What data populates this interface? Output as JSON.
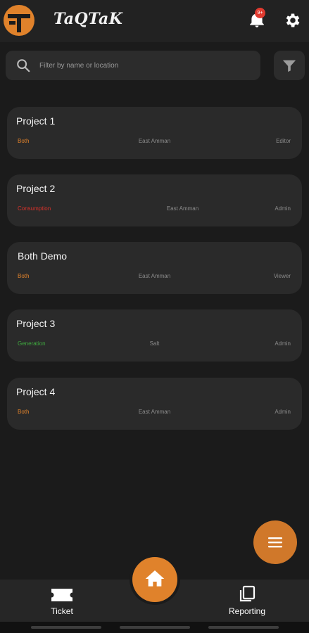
{
  "colors": {
    "accent": "#e0822b",
    "background": "#1b1b1b",
    "card": "#2a2a2a",
    "type_both": "#e0822b",
    "type_consumption": "#d9322a",
    "type_generation": "#3fa83f"
  },
  "header": {
    "title": "TaQTaK",
    "logo_icon": "taqtak-logo-icon",
    "notifications_icon": "bell-icon",
    "notifications_badge": "9+",
    "settings_icon": "gear-icon"
  },
  "search": {
    "placeholder": "Filter by name or location",
    "value": "",
    "icon": "search-icon",
    "filter_icon": "filter-icon"
  },
  "projects": [
    {
      "name": "Project 1",
      "type": "Both",
      "type_color": "#e0822b",
      "location": "East Amman",
      "role": "Editor"
    },
    {
      "name": "Project 2",
      "type": "Consumption",
      "type_color": "#d9322a",
      "location": "East Amman",
      "role": "Admin"
    },
    {
      "name": "Both Demo",
      "type": "Both",
      "type_color": "#e0822b",
      "location": "East Amman",
      "role": "Viewer"
    },
    {
      "name": "Project 3",
      "type": "Generation",
      "type_color": "#3fa83f",
      "location": "Salt",
      "role": "Admin"
    },
    {
      "name": "Project 4",
      "type": "Both",
      "type_color": "#e0822b",
      "location": "East Amman",
      "role": "Admin"
    }
  ],
  "fab": {
    "icon": "menu-icon"
  },
  "bottom_nav": {
    "ticket": {
      "label": "Ticket",
      "icon": "ticket-icon"
    },
    "home": {
      "icon": "home-icon"
    },
    "reporting": {
      "label": "Reporting",
      "icon": "copy-icon"
    }
  }
}
